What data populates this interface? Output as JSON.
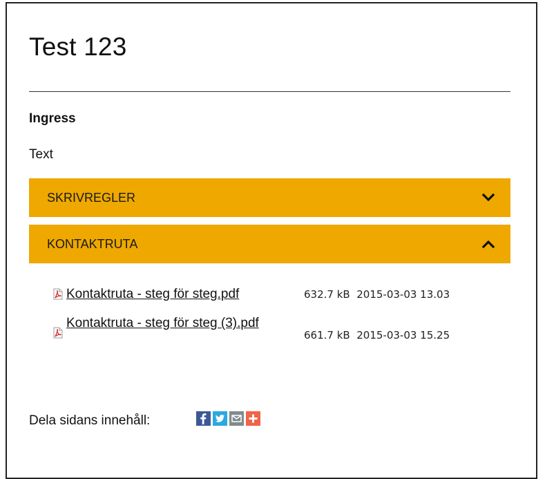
{
  "page": {
    "title": "Test 123",
    "ingress_label": "Ingress",
    "body_text": "Text"
  },
  "accordions": [
    {
      "label": "SKRIVREGLER",
      "state": "collapsed",
      "chevron": "chevron-down-icon"
    },
    {
      "label": "KONTAKTRUTA",
      "state": "expanded",
      "chevron": "chevron-up-icon"
    }
  ],
  "files": [
    {
      "name": "Kontaktruta - steg för steg.pdf",
      "size": "632.7 kB",
      "date": "2015-03-03 13.03",
      "icon": "pdf-icon"
    },
    {
      "name": "Kontaktruta - steg för steg (3).pdf",
      "size": "661.7 kB",
      "date": "2015-03-03 15.25",
      "icon": "pdf-icon"
    }
  ],
  "share": {
    "label": "Dela sidans innehåll:",
    "buttons": [
      {
        "icon": "facebook-icon",
        "color": "#3b5998"
      },
      {
        "icon": "twitter-icon",
        "color": "#2aa9e0"
      },
      {
        "icon": "email-icon",
        "color": "#7f8c8d"
      },
      {
        "icon": "share-more-icon",
        "color": "#f0644a"
      }
    ]
  },
  "colors": {
    "accordion_bg": "#eea800",
    "text": "#111111"
  }
}
